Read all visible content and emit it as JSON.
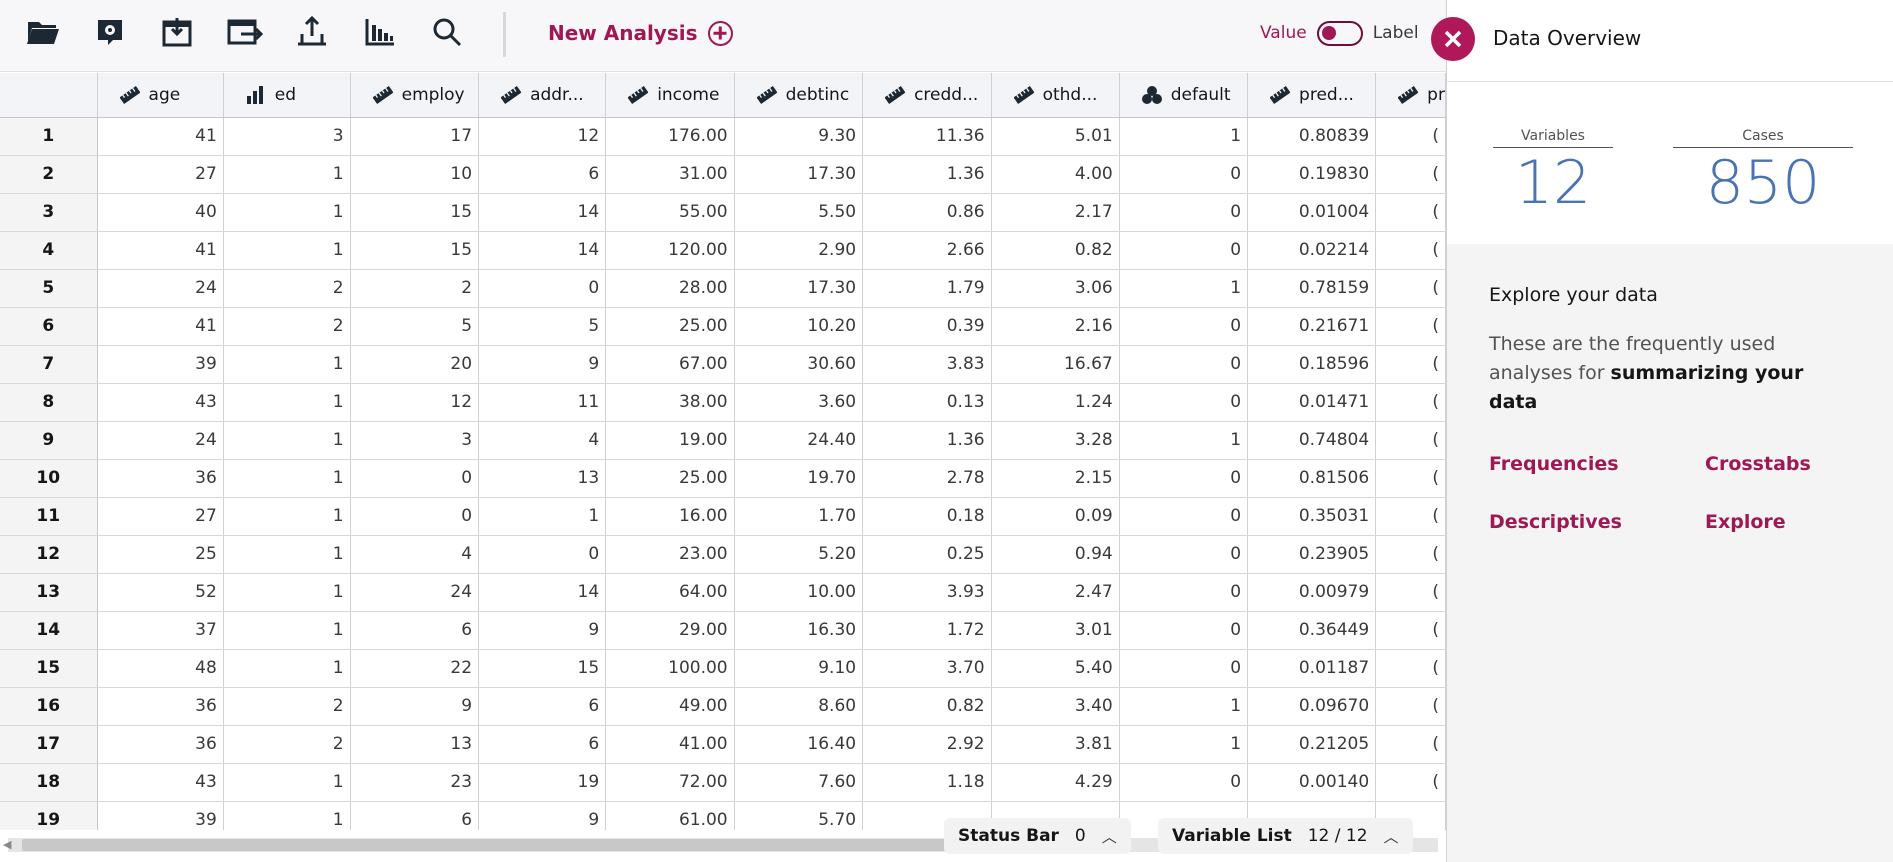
{
  "toolbar": {
    "icons": [
      "open-folder-icon",
      "open-data-icon",
      "import-icon",
      "export-icon",
      "share-icon",
      "chart-builder-icon",
      "search-icon"
    ],
    "new_analysis_label": "New Analysis",
    "toggle": {
      "value_label": "Value",
      "label_label": "Label"
    }
  },
  "grid": {
    "columns": [
      {
        "name": "age",
        "icon": "scale-ruler-icon"
      },
      {
        "name": "ed",
        "icon": "ordinal-bars-icon"
      },
      {
        "name": "employ",
        "icon": "scale-ruler-icon"
      },
      {
        "name": "addr...",
        "icon": "scale-ruler-icon"
      },
      {
        "name": "income",
        "icon": "scale-ruler-icon"
      },
      {
        "name": "debtinc",
        "icon": "scale-ruler-icon"
      },
      {
        "name": "credd...",
        "icon": "scale-ruler-icon"
      },
      {
        "name": "othd...",
        "icon": "scale-ruler-icon"
      },
      {
        "name": "default",
        "icon": "nominal-circles-icon"
      },
      {
        "name": "pred...",
        "icon": "scale-ruler-icon"
      },
      {
        "name": "pr",
        "icon": "scale-ruler-icon"
      }
    ],
    "rows": [
      [
        "1",
        "41",
        "3",
        "17",
        "12",
        "176.00",
        "9.30",
        "11.36",
        "5.01",
        "1",
        "0.80839",
        "("
      ],
      [
        "2",
        "27",
        "1",
        "10",
        "6",
        "31.00",
        "17.30",
        "1.36",
        "4.00",
        "0",
        "0.19830",
        "("
      ],
      [
        "3",
        "40",
        "1",
        "15",
        "14",
        "55.00",
        "5.50",
        "0.86",
        "2.17",
        "0",
        "0.01004",
        "("
      ],
      [
        "4",
        "41",
        "1",
        "15",
        "14",
        "120.00",
        "2.90",
        "2.66",
        "0.82",
        "0",
        "0.02214",
        "("
      ],
      [
        "5",
        "24",
        "2",
        "2",
        "0",
        "28.00",
        "17.30",
        "1.79",
        "3.06",
        "1",
        "0.78159",
        "("
      ],
      [
        "6",
        "41",
        "2",
        "5",
        "5",
        "25.00",
        "10.20",
        "0.39",
        "2.16",
        "0",
        "0.21671",
        "("
      ],
      [
        "7",
        "39",
        "1",
        "20",
        "9",
        "67.00",
        "30.60",
        "3.83",
        "16.67",
        "0",
        "0.18596",
        "("
      ],
      [
        "8",
        "43",
        "1",
        "12",
        "11",
        "38.00",
        "3.60",
        "0.13",
        "1.24",
        "0",
        "0.01471",
        "("
      ],
      [
        "9",
        "24",
        "1",
        "3",
        "4",
        "19.00",
        "24.40",
        "1.36",
        "3.28",
        "1",
        "0.74804",
        "("
      ],
      [
        "10",
        "36",
        "1",
        "0",
        "13",
        "25.00",
        "19.70",
        "2.78",
        "2.15",
        "0",
        "0.81506",
        "("
      ],
      [
        "11",
        "27",
        "1",
        "0",
        "1",
        "16.00",
        "1.70",
        "0.18",
        "0.09",
        "0",
        "0.35031",
        "("
      ],
      [
        "12",
        "25",
        "1",
        "4",
        "0",
        "23.00",
        "5.20",
        "0.25",
        "0.94",
        "0",
        "0.23905",
        "("
      ],
      [
        "13",
        "52",
        "1",
        "24",
        "14",
        "64.00",
        "10.00",
        "3.93",
        "2.47",
        "0",
        "0.00979",
        "("
      ],
      [
        "14",
        "37",
        "1",
        "6",
        "9",
        "29.00",
        "16.30",
        "1.72",
        "3.01",
        "0",
        "0.36449",
        "("
      ],
      [
        "15",
        "48",
        "1",
        "22",
        "15",
        "100.00",
        "9.10",
        "3.70",
        "5.40",
        "0",
        "0.01187",
        "("
      ],
      [
        "16",
        "36",
        "2",
        "9",
        "6",
        "49.00",
        "8.60",
        "0.82",
        "3.40",
        "1",
        "0.09670",
        "("
      ],
      [
        "17",
        "36",
        "2",
        "13",
        "6",
        "41.00",
        "16.40",
        "2.92",
        "3.81",
        "1",
        "0.21205",
        "("
      ],
      [
        "18",
        "43",
        "1",
        "23",
        "19",
        "72.00",
        "7.60",
        "1.18",
        "4.29",
        "0",
        "0.00140",
        "("
      ],
      [
        "19",
        "39",
        "1",
        "6",
        "9",
        "61.00",
        "5.70",
        "",
        "",
        "",
        "",
        ""
      ]
    ]
  },
  "status_bar": {
    "label": "Status Bar",
    "count": "0"
  },
  "variable_list": {
    "label": "Variable List",
    "count": "12 / 12"
  },
  "panel": {
    "title": "Data Overview",
    "variables_label": "Variables",
    "variables_value": "12",
    "cases_label": "Cases",
    "cases_value": "850",
    "explore_heading": "Explore your data",
    "explore_text": "These are the frequently used analyses for ",
    "explore_bold": "summarizing your data",
    "links": [
      "Frequencies",
      "Crosstabs",
      "Descriptives",
      "Explore"
    ]
  },
  "colors": {
    "accent": "#9f1853",
    "stat_blue": "#4a73b3"
  }
}
